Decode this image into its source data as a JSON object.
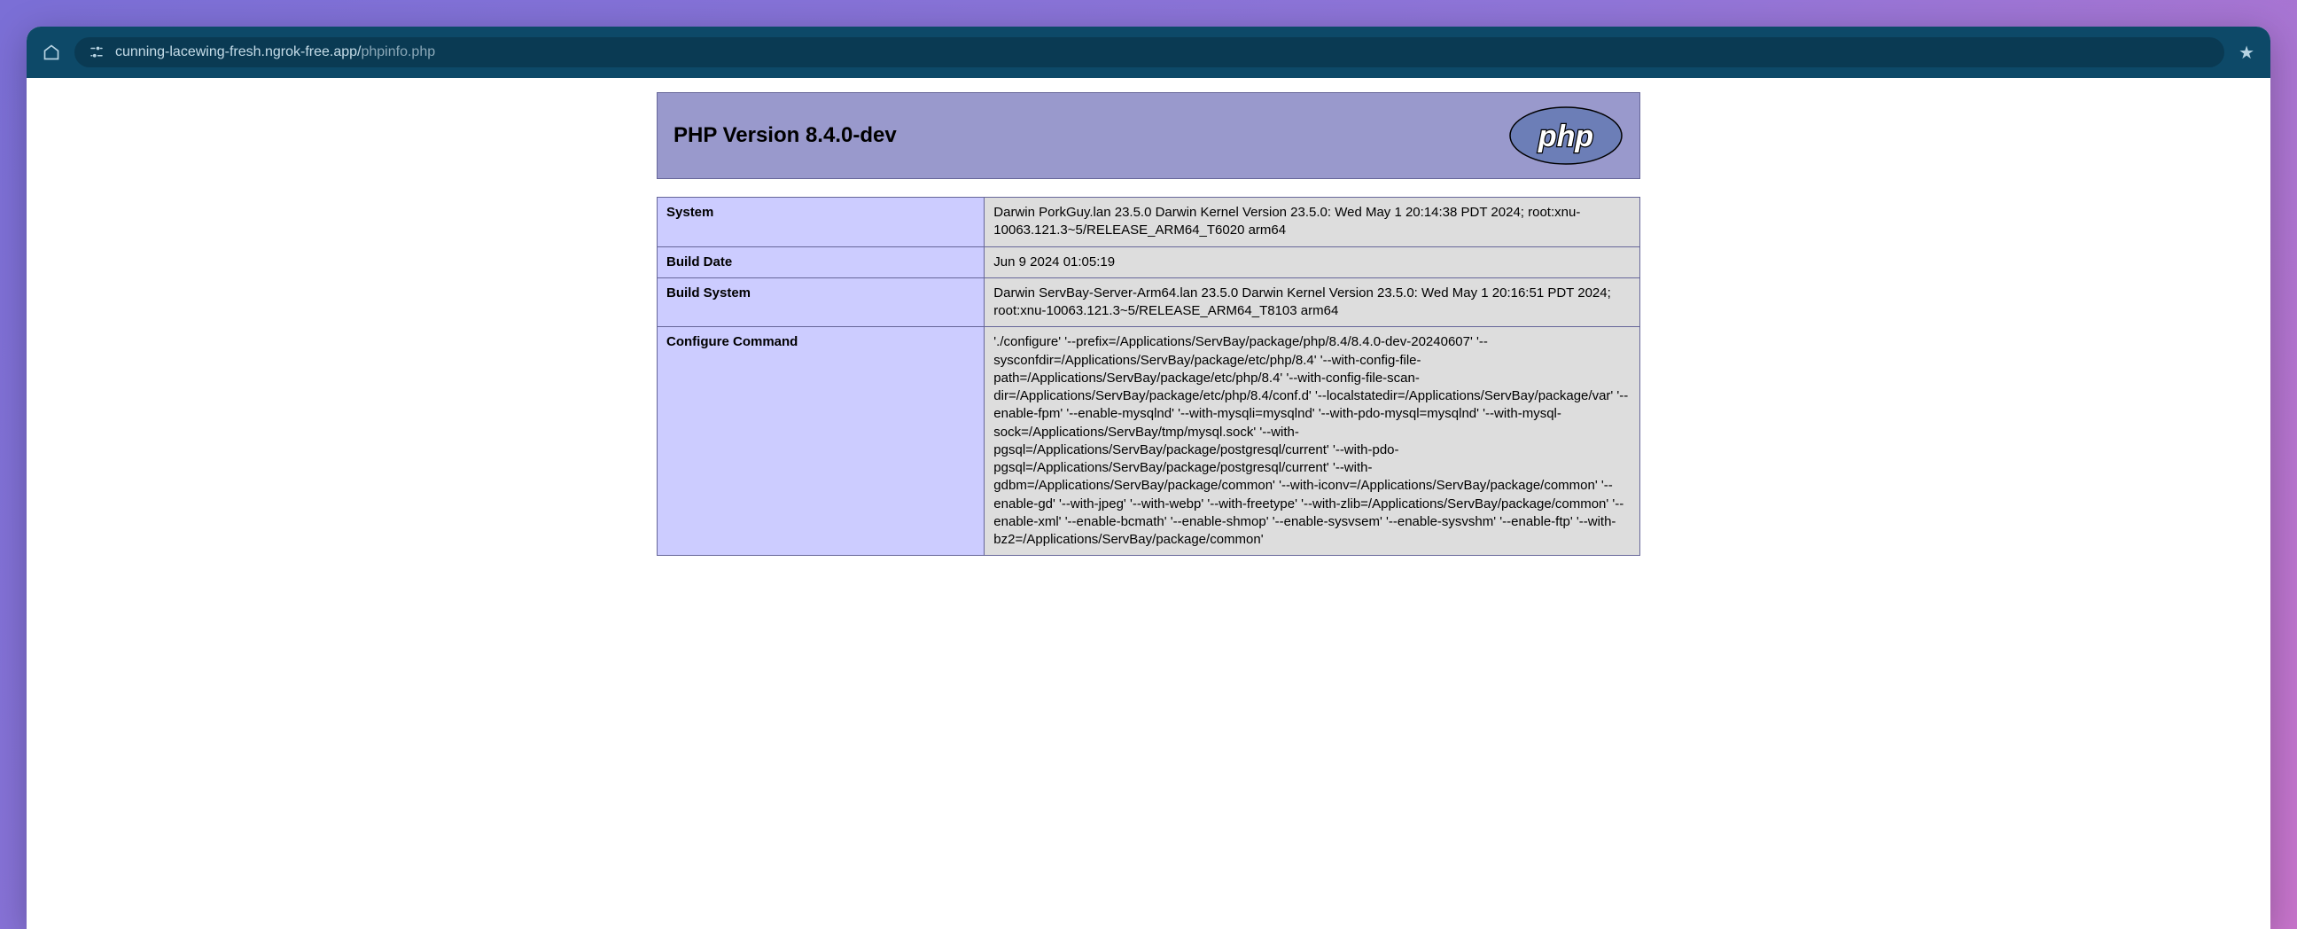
{
  "browser": {
    "url_host": "cunning-lacewing-fresh.ngrok-free.app/",
    "url_path": "phpinfo.php"
  },
  "phpinfo": {
    "title": "PHP Version 8.4.0-dev",
    "rows": [
      {
        "label": "System",
        "value": "Darwin PorkGuy.lan 23.5.0 Darwin Kernel Version 23.5.0: Wed May 1 20:14:38 PDT 2024; root:xnu-10063.121.3~5/RELEASE_ARM64_T6020 arm64"
      },
      {
        "label": "Build Date",
        "value": "Jun 9 2024 01:05:19"
      },
      {
        "label": "Build System",
        "value": "Darwin ServBay-Server-Arm64.lan 23.5.0 Darwin Kernel Version 23.5.0: Wed May 1 20:16:51 PDT 2024; root:xnu-10063.121.3~5/RELEASE_ARM64_T8103 arm64"
      },
      {
        "label": "Configure Command",
        "value": "'./configure' '--prefix=/Applications/ServBay/package/php/8.4/8.4.0-dev-20240607' '--sysconfdir=/Applications/ServBay/package/etc/php/8.4' '--with-config-file-path=/Applications/ServBay/package/etc/php/8.4' '--with-config-file-scan-dir=/Applications/ServBay/package/etc/php/8.4/conf.d' '--localstatedir=/Applications/ServBay/package/var' '--enable-fpm' '--enable-mysqlnd' '--with-mysqli=mysqlnd' '--with-pdo-mysql=mysqlnd' '--with-mysql-sock=/Applications/ServBay/tmp/mysql.sock' '--with-pgsql=/Applications/ServBay/package/postgresql/current' '--with-pdo-pgsql=/Applications/ServBay/package/postgresql/current' '--with-gdbm=/Applications/ServBay/package/common' '--with-iconv=/Applications/ServBay/package/common' '--enable-gd' '--with-jpeg' '--with-webp' '--with-freetype' '--with-zlib=/Applications/ServBay/package/common' '--enable-xml' '--enable-bcmath' '--enable-shmop' '--enable-sysvsem' '--enable-sysvshm' '--enable-ftp' '--with-bz2=/Applications/ServBay/package/common'"
      }
    ]
  }
}
